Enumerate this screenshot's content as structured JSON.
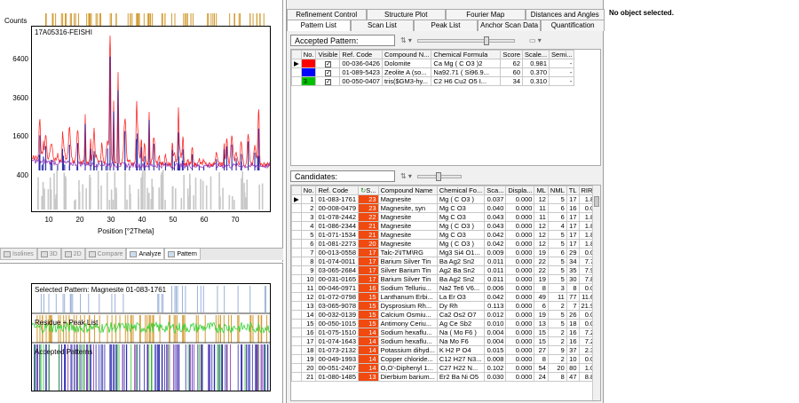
{
  "plot": {
    "ylabel": "Counts",
    "sample_name": "17A05316-FEISHI",
    "y_ticks": [
      "6400",
      "3600",
      "1600",
      "400"
    ],
    "x_ticks": [
      "10",
      "20",
      "30",
      "40",
      "50",
      "60",
      "70"
    ],
    "xlabel": "Position [°2Theta]"
  },
  "bottom_tabs": [
    "Isolines",
    "3D",
    "2D",
    "Compare",
    "Analyze",
    "Pattern"
  ],
  "lower": {
    "selected_label": "Selected Pattern: Magnesite  01-083-1761",
    "residue_label": "Residue + Peak List",
    "accepted_label": "Accepted Patterns"
  },
  "tabs_top": [
    "Refinement Control",
    "Structure Plot",
    "Fourier Map",
    "Distances and Angles"
  ],
  "tabs_bottom": [
    "Pattern List",
    "Scan List",
    "Peak List",
    "Anchor Scan Data",
    "Quantification"
  ],
  "accepted": {
    "title": "Accepted Pattern:",
    "columns": [
      "No.",
      "Visible",
      "Ref. Code",
      "Compound N...",
      "Chemical Formula",
      "Score",
      "Scale...",
      "Semi..."
    ],
    "rows": [
      {
        "no": "1",
        "color": "#ff0000",
        "ref": "00-036-0426",
        "name": "Dolomite",
        "formula": "Ca Mg ( C O3 )2",
        "score": "62",
        "scale": "0.981",
        "semi": "-"
      },
      {
        "no": "2",
        "color": "#0000ff",
        "ref": "01-089-5423",
        "name": "Zeolite A (so...",
        "formula": "Na92.71 ( Si96.9...",
        "score": "60",
        "scale": "0.370",
        "semi": "-"
      },
      {
        "no": "3",
        "color": "#00c000",
        "ref": "00-050-0407",
        "name": "tris($GM3-hy...",
        "formula": "C2 H6 Cu2 O5 I...",
        "score": "34",
        "scale": "0.310",
        "semi": "-"
      }
    ]
  },
  "candidates": {
    "title": "Candidates:",
    "columns": [
      "No.",
      "Ref. Code",
      "S...",
      "Compound Name",
      "Chemical Fo...",
      "Sca...",
      "Displa...",
      "ML",
      "NML",
      "TL",
      "RIR"
    ],
    "rows": [
      {
        "no": "1",
        "ref": "01-083-1761",
        "s": "23",
        "name": "Magnesite",
        "formula": "Mg ( C O3 )",
        "sca": "0.037",
        "disp": "0.000",
        "ml": "12",
        "nml": "5",
        "tl": "17",
        "rir": "1.830"
      },
      {
        "no": "2",
        "ref": "00-008-0479",
        "s": "23",
        "name": "Magnesite, syn",
        "formula": "Mg C O3",
        "sca": "0.040",
        "disp": "0.000",
        "ml": "11",
        "nml": "6",
        "tl": "16",
        "rir": "0.000"
      },
      {
        "no": "3",
        "ref": "01-078-2442",
        "s": "22",
        "name": "Magnesite",
        "formula": "Mg C O3",
        "sca": "0.043",
        "disp": "0.000",
        "ml": "11",
        "nml": "6",
        "tl": "17",
        "rir": "1.820"
      },
      {
        "no": "4",
        "ref": "01-086-2344",
        "s": "21",
        "name": "Magnesite",
        "formula": "Mg ( C O3 )",
        "sca": "0.043",
        "disp": "0.000",
        "ml": "12",
        "nml": "4",
        "tl": "17",
        "rir": "1.820"
      },
      {
        "no": "5",
        "ref": "01-071-1534",
        "s": "21",
        "name": "Magnesite",
        "formula": "Mg C O3",
        "sca": "0.042",
        "disp": "0.000",
        "ml": "12",
        "nml": "5",
        "tl": "17",
        "rir": "1.830"
      },
      {
        "no": "6",
        "ref": "01-081-2273",
        "s": "20",
        "name": "Magnesite",
        "formula": "Mg ( C O3 )",
        "sca": "0.042",
        "disp": "0.000",
        "ml": "12",
        "nml": "5",
        "tl": "17",
        "rir": "1.820"
      },
      {
        "no": "7",
        "ref": "00-013-0558",
        "s": "17",
        "name": "Talc-2\\ITM\\RG",
        "formula": "Mg3 Si4 O1...",
        "sca": "0.009",
        "disp": "0.000",
        "ml": "19",
        "nml": "6",
        "tl": "29",
        "rir": "0.000"
      },
      {
        "no": "8",
        "ref": "01-074-0011",
        "s": "17",
        "name": "Barium Silver Tin",
        "formula": "Ba Ag2 Sn2",
        "sca": "0.011",
        "disp": "0.000",
        "ml": "22",
        "nml": "5",
        "tl": "34",
        "rir": "7.730"
      },
      {
        "no": "9",
        "ref": "03-065-2684",
        "s": "17",
        "name": "Silver Barium Tin",
        "formula": "Ag2 Ba Sn2",
        "sca": "0.011",
        "disp": "0.000",
        "ml": "22",
        "nml": "5",
        "tl": "35",
        "rir": "7.960"
      },
      {
        "no": "10",
        "ref": "00-031-0165",
        "s": "17",
        "name": "Barium Silver Tin",
        "formula": "Ba Ag2 Sn2",
        "sca": "0.011",
        "disp": "0.000",
        "ml": "19",
        "nml": "5",
        "tl": "30",
        "rir": "7.880"
      },
      {
        "no": "11",
        "ref": "00-046-0971",
        "s": "16",
        "name": "Sodium Telluriu...",
        "formula": "Na2 Te6 V6...",
        "sca": "0.006",
        "disp": "0.000",
        "ml": "8",
        "nml": "3",
        "tl": "8",
        "rir": "0.000"
      },
      {
        "no": "12",
        "ref": "01-072-0798",
        "s": "15",
        "name": "Lanthanum Erbi...",
        "formula": "La Er O3",
        "sca": "0.042",
        "disp": "0.000",
        "ml": "49",
        "nml": "11",
        "tl": "77",
        "rir": "11.670"
      },
      {
        "no": "13",
        "ref": "03-065-9078",
        "s": "15",
        "name": "Dysprosium Rh...",
        "formula": "Dy Rh",
        "sca": "0.113",
        "disp": "0.000",
        "ml": "6",
        "nml": "2",
        "tl": "7",
        "rir": "21.970"
      },
      {
        "no": "14",
        "ref": "00-032-0139",
        "s": "15",
        "name": "Calcium Osmiu...",
        "formula": "Ca2 Os2 O7",
        "sca": "0.012",
        "disp": "0.000",
        "ml": "19",
        "nml": "5",
        "tl": "26",
        "rir": "0.000"
      },
      {
        "no": "15",
        "ref": "00-050-1015",
        "s": "15",
        "name": "Antimony Ceriu...",
        "formula": "Ag Ce Sb2",
        "sca": "0.010",
        "disp": "0.000",
        "ml": "13",
        "nml": "5",
        "tl": "18",
        "rir": "0.000"
      },
      {
        "no": "16",
        "ref": "01-075-1510",
        "s": "14",
        "name": "Sodium hexaflu...",
        "formula": "Na ( Mo F6 )",
        "sca": "0.004",
        "disp": "0.000",
        "ml": "15",
        "nml": "2",
        "tl": "16",
        "rir": "7.230"
      },
      {
        "no": "17",
        "ref": "01-074-1643",
        "s": "14",
        "name": "Sodium hexaflu...",
        "formula": "Na Mo F6",
        "sca": "0.004",
        "disp": "0.000",
        "ml": "15",
        "nml": "2",
        "tl": "16",
        "rir": "7.230"
      },
      {
        "no": "18",
        "ref": "01-073-2132",
        "s": "14",
        "name": "Potassium dihyd...",
        "formula": "K H2 P O4",
        "sca": "0.015",
        "disp": "0.000",
        "ml": "27",
        "nml": "9",
        "tl": "37",
        "rir": "2.380"
      },
      {
        "no": "19",
        "ref": "00-049-1993",
        "s": "14",
        "name": "Copper chloride...",
        "formula": "C12 H27 N3...",
        "sca": "0.008",
        "disp": "0.000",
        "ml": "8",
        "nml": "2",
        "tl": "10",
        "rir": "0.000"
      },
      {
        "no": "20",
        "ref": "00-051-2407",
        "s": "14",
        "name": "O,O'-Diphenyl 1...",
        "formula": "C27 H22 N...",
        "sca": "0.102",
        "disp": "0.000",
        "ml": "54",
        "nml": "20",
        "tl": "80",
        "rir": "1.003"
      },
      {
        "no": "21",
        "ref": "01-080-1485",
        "s": "13",
        "name": "Dierbium barium...",
        "formula": "Er2 Ba Ni O5",
        "sca": "0.030",
        "disp": "0.000",
        "ml": "24",
        "nml": "8",
        "tl": "47",
        "rir": "8.830"
      }
    ]
  },
  "right": {
    "status": "No object selected."
  }
}
